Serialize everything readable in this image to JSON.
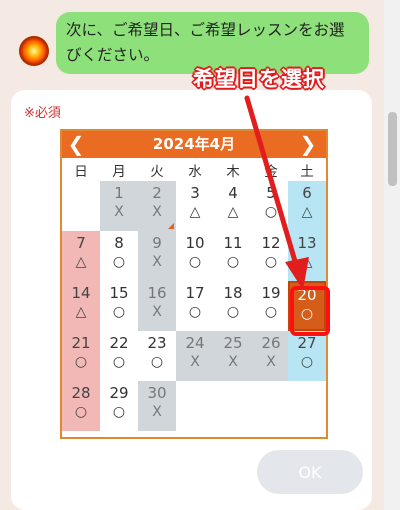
{
  "chat": {
    "message_line1": "次に、ご希望日、ご希望レッスンをお選",
    "message_line2": "びください。"
  },
  "form": {
    "required_label": "※必須",
    "ok_label": "OK"
  },
  "calendar": {
    "prev_icon": "chevron-left-icon",
    "next_icon": "chevron-right-icon",
    "month_label": "2024年4月",
    "weekdays": [
      "日",
      "月",
      "火",
      "水",
      "木",
      "金",
      "土"
    ],
    "days": [
      {
        "day": "1",
        "mark": "X",
        "status": "closed"
      },
      {
        "day": "2",
        "mark": "X",
        "status": "closed"
      },
      {
        "day": "3",
        "mark": "△",
        "status": "open"
      },
      {
        "day": "4",
        "mark": "△",
        "status": "open"
      },
      {
        "day": "5",
        "mark": "○",
        "status": "open"
      },
      {
        "day": "6",
        "mark": "△",
        "status": "saturday"
      },
      {
        "day": "7",
        "mark": "△",
        "status": "sunday"
      },
      {
        "day": "8",
        "mark": "○",
        "status": "open"
      },
      {
        "day": "9",
        "mark": "X",
        "status": "closed"
      },
      {
        "day": "10",
        "mark": "○",
        "status": "open"
      },
      {
        "day": "11",
        "mark": "○",
        "status": "open"
      },
      {
        "day": "12",
        "mark": "○",
        "status": "open"
      },
      {
        "day": "13",
        "mark": "△",
        "status": "saturday"
      },
      {
        "day": "14",
        "mark": "△",
        "status": "sunday"
      },
      {
        "day": "15",
        "mark": "○",
        "status": "open"
      },
      {
        "day": "16",
        "mark": "X",
        "status": "closed"
      },
      {
        "day": "17",
        "mark": "○",
        "status": "open"
      },
      {
        "day": "18",
        "mark": "○",
        "status": "open"
      },
      {
        "day": "19",
        "mark": "○",
        "status": "open"
      },
      {
        "day": "20",
        "mark": "○",
        "status": "selected"
      },
      {
        "day": "21",
        "mark": "○",
        "status": "sunday"
      },
      {
        "day": "22",
        "mark": "○",
        "status": "open"
      },
      {
        "day": "23",
        "mark": "○",
        "status": "open"
      },
      {
        "day": "24",
        "mark": "X",
        "status": "closed"
      },
      {
        "day": "25",
        "mark": "X",
        "status": "closed"
      },
      {
        "day": "26",
        "mark": "X",
        "status": "closed"
      },
      {
        "day": "27",
        "mark": "○",
        "status": "saturday"
      },
      {
        "day": "28",
        "mark": "○",
        "status": "sunday"
      },
      {
        "day": "29",
        "mark": "○",
        "status": "open"
      },
      {
        "day": "30",
        "mark": "X",
        "status": "closed"
      }
    ]
  },
  "annotation": {
    "callout_text": "希望日を選択",
    "color": "#e11d1d"
  },
  "colors": {
    "header": "#ea6b22",
    "selected": "#d65c1a",
    "bubble": "#8ee07a",
    "closed": "#d1d6db",
    "sunday": "#f2b8b5",
    "saturday": "#b7e5f4"
  }
}
